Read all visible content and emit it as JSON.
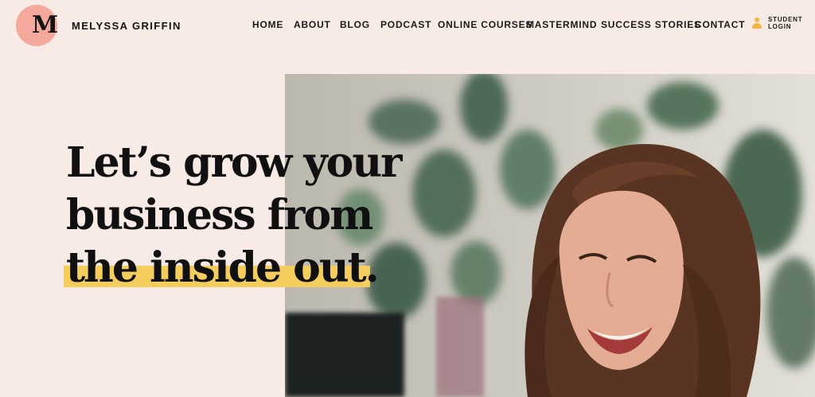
{
  "brand": {
    "logo_letter": "M",
    "name": "MELYSSA GRIFFIN",
    "logo_color": "#f4a99c"
  },
  "nav": {
    "items": [
      {
        "label": "HOME"
      },
      {
        "label": "ABOUT"
      },
      {
        "label": "BLOG"
      },
      {
        "label": "PODCAST"
      },
      {
        "label": "ONLINE COURSES"
      },
      {
        "label": "MASTERMIND"
      },
      {
        "label": "SUCCESS STORIES"
      },
      {
        "label": "CONTACT"
      }
    ],
    "login": {
      "line1": "STUDENT",
      "line2": "LOGIN",
      "icon": "user-icon",
      "icon_color": "#f3b644"
    }
  },
  "hero": {
    "headline_lines": [
      "Let’s grow your",
      "business from",
      "the inside out."
    ],
    "highlight_color": "#f4cd5c",
    "background_color": "#f8ebe5"
  }
}
